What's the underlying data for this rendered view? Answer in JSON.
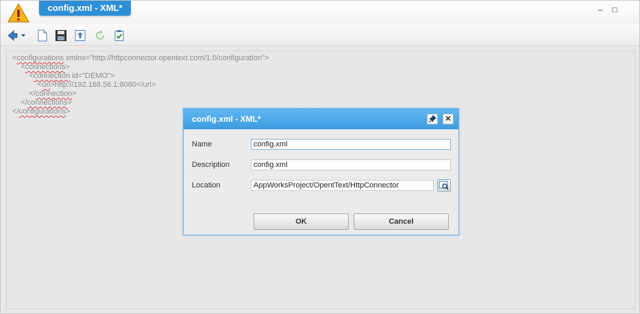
{
  "window": {
    "tab_title": "config.xml - XML*",
    "minimize_symbol": "–",
    "maximize_symbol": "□"
  },
  "toolbar": {
    "items": [
      "back-dropdown",
      "new-document",
      "save",
      "publish",
      "refresh",
      "validate"
    ]
  },
  "editor": {
    "lines": [
      "<configurations xmlns=\"http://httpconnector.opentext.com/1.0/configuration\">",
      "    <connections>",
      "        <connection id=\"DEMO\">",
      "            <url>http://192.168.56.1:8080</url>",
      "        </connection>",
      "    </connections>",
      "</configurations>"
    ]
  },
  "dialog": {
    "title": "config.xml - XML*",
    "pin_symbol": "📌",
    "close_symbol": "✕",
    "name_label": "Name",
    "name_value": "config.xml",
    "description_label": "Description",
    "description_value": "config.xml",
    "location_label": "Location",
    "location_value": "AppWorksProject/OpentText/HttpConnector",
    "ok_label": "OK",
    "cancel_label": "Cancel"
  },
  "colors": {
    "accent": "#2e8fd6",
    "dialog_header": "#4aa6e6"
  }
}
